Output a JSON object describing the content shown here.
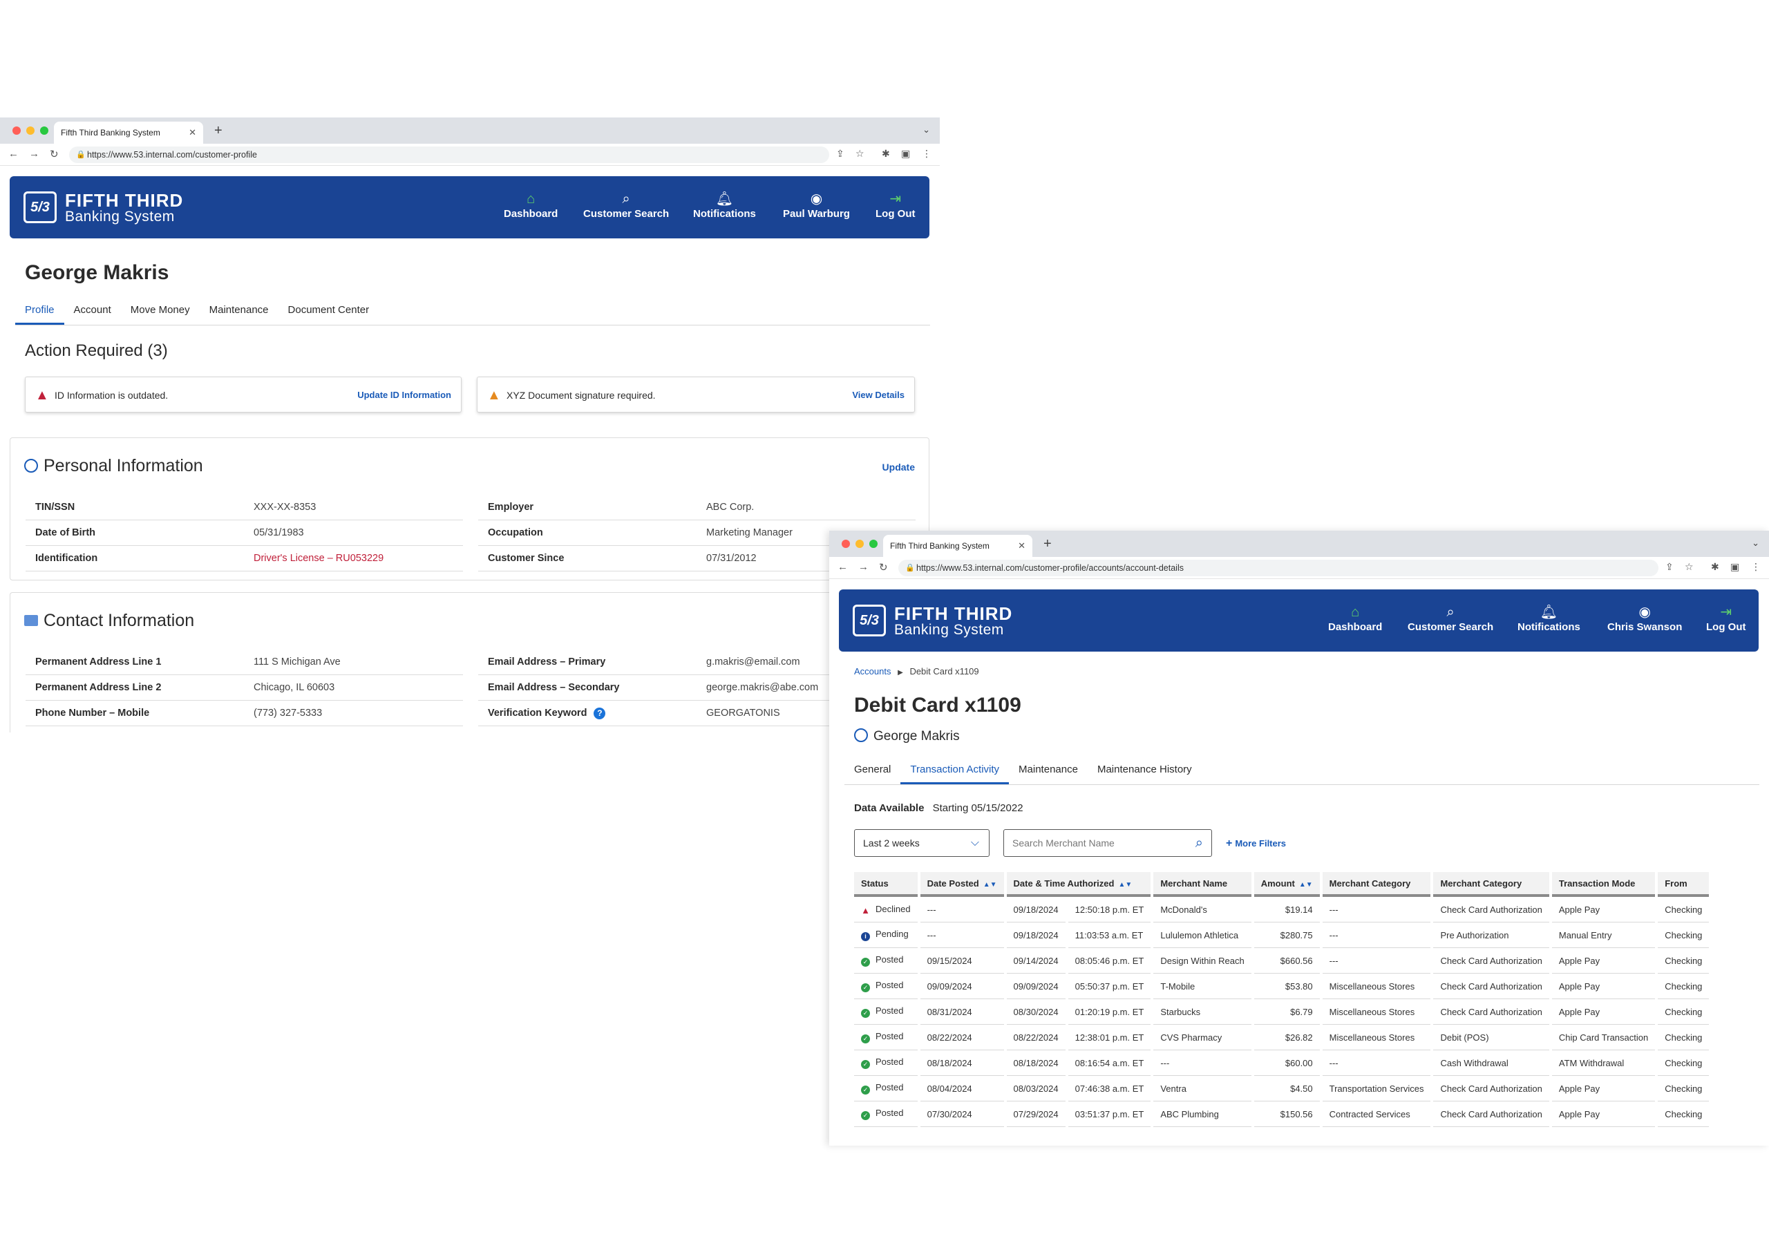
{
  "colors": {
    "brand": "#1a4494",
    "link": "#1a5bb8",
    "alert_red": "#c0203a",
    "alert_orange": "#e58a1f",
    "posted_green": "#2e9e4a"
  },
  "window1": {
    "browser": {
      "tab_title": "Fifth Third Banking System",
      "url": "https://www.53.internal.com/customer-profile"
    },
    "header": {
      "logo_mark": "5/3",
      "logo_line1": "FIFTH THIRD",
      "logo_line2": "Banking System",
      "nav": {
        "dashboard": "Dashboard",
        "search": "Customer Search",
        "notifications": "Notifications",
        "user": "Paul Warburg",
        "logout": "Log Out"
      }
    },
    "customer_name": "George Makris",
    "tabs": [
      "Profile",
      "Account",
      "Move Money",
      "Maintenance",
      "Document Center"
    ],
    "action_required": {
      "title": "Action Required (3)",
      "alerts": [
        {
          "message": "ID Information is outdated.",
          "link": "Update ID Information"
        },
        {
          "message": "XYZ Document signature required.",
          "link": "View Details"
        }
      ]
    },
    "personal": {
      "title": "Personal Information",
      "update_label": "Update",
      "left": [
        {
          "label": "TIN/SSN",
          "value": "XXX-XX-8353"
        },
        {
          "label": "Date of Birth",
          "value": "05/31/1983"
        },
        {
          "label": "Identification",
          "value": "Driver's License – RU053229"
        }
      ],
      "right": [
        {
          "label": "Employer",
          "value": "ABC Corp."
        },
        {
          "label": "Occupation",
          "value": "Marketing Manager"
        },
        {
          "label": "Customer Since",
          "value": "07/31/2012"
        }
      ]
    },
    "contact": {
      "title": "Contact Information",
      "left": [
        {
          "label": "Permanent Address Line 1",
          "value": "111 S Michigan Ave"
        },
        {
          "label": "Permanent Address Line 2",
          "value": "Chicago, IL 60603"
        },
        {
          "label": "Phone Number – Mobile",
          "value": "(773) 327-5333"
        }
      ],
      "right": [
        {
          "label": "Email Address – Primary",
          "value": "g.makris@email.com"
        },
        {
          "label": "Email Address – Secondary",
          "value": "george.makris@abe.com"
        },
        {
          "label": "Verification Keyword",
          "value": "GEORGATONIS"
        }
      ]
    }
  },
  "window2": {
    "browser": {
      "tab_title": "Fifth Third Banking System",
      "url": "https://www.53.internal.com/customer-profile/accounts/account-details"
    },
    "header": {
      "logo_mark": "5/3",
      "logo_line1": "FIFTH THIRD",
      "logo_line2": "Banking System",
      "nav": {
        "dashboard": "Dashboard",
        "search": "Customer Search",
        "notifications": "Notifications",
        "user": "Chris Swanson",
        "logout": "Log Out"
      }
    },
    "breadcrumb": {
      "parent": "Accounts",
      "current": "Debit Card x1109"
    },
    "title": "Debit Card x1109",
    "owner": "George Makris",
    "tabs": [
      "General",
      "Transaction Activity",
      "Maintenance",
      "Maintenance History"
    ],
    "data_available": {
      "label": "Data Available",
      "value": "Starting 05/15/2022"
    },
    "filters": {
      "range": "Last 2 weeks",
      "search_placeholder": "Search Merchant Name",
      "more_filters": "More Filters"
    },
    "columns": [
      "Status",
      "Date Posted",
      "Date & Time Authorized",
      "Merchant Name",
      "Amount",
      "Merchant Category",
      "Merchant Category",
      "Transaction Mode",
      "From"
    ],
    "rows": [
      {
        "status": "Declined",
        "posted": "---",
        "auth_date": "09/18/2024",
        "auth_time": "12:50:18 p.m. ET",
        "merchant": "McDonald's",
        "amount": "$19.14",
        "cat1": "---",
        "cat2": "Check Card Authorization",
        "mode": "Apple Pay",
        "from": "Checking"
      },
      {
        "status": "Pending",
        "posted": "---",
        "auth_date": "09/18/2024",
        "auth_time": "11:03:53 a.m. ET",
        "merchant": "Lululemon Athletica",
        "amount": "$280.75",
        "cat1": "---",
        "cat2": "Pre Authorization",
        "mode": "Manual Entry",
        "from": "Checking"
      },
      {
        "status": "Posted",
        "posted": "09/15/2024",
        "auth_date": "09/14/2024",
        "auth_time": "08:05:46 p.m. ET",
        "merchant": "Design Within Reach",
        "amount": "$660.56",
        "cat1": "---",
        "cat2": "Check Card Authorization",
        "mode": "Apple Pay",
        "from": "Checking"
      },
      {
        "status": "Posted",
        "posted": "09/09/2024",
        "auth_date": "09/09/2024",
        "auth_time": "05:50:37 p.m. ET",
        "merchant": "T-Mobile",
        "amount": "$53.80",
        "cat1": "Miscellaneous Stores",
        "cat2": "Check Card Authorization",
        "mode": "Apple Pay",
        "from": "Checking"
      },
      {
        "status": "Posted",
        "posted": "08/31/2024",
        "auth_date": "08/30/2024",
        "auth_time": "01:20:19 p.m. ET",
        "merchant": "Starbucks",
        "amount": "$6.79",
        "cat1": "Miscellaneous Stores",
        "cat2": "Check Card Authorization",
        "mode": "Apple Pay",
        "from": "Checking"
      },
      {
        "status": "Posted",
        "posted": "08/22/2024",
        "auth_date": "08/22/2024",
        "auth_time": "12:38:01 p.m. ET",
        "merchant": "CVS Pharmacy",
        "amount": "$26.82",
        "cat1": "Miscellaneous Stores",
        "cat2": "Debit (POS)",
        "mode": "Chip Card Transaction",
        "from": "Checking"
      },
      {
        "status": "Posted",
        "posted": "08/18/2024",
        "auth_date": "08/18/2024",
        "auth_time": "08:16:54 a.m. ET",
        "merchant": "---",
        "amount": "$60.00",
        "cat1": "---",
        "cat2": "Cash Withdrawal",
        "mode": "ATM Withdrawal",
        "from": "Checking"
      },
      {
        "status": "Posted",
        "posted": "08/04/2024",
        "auth_date": "08/03/2024",
        "auth_time": "07:46:38 a.m. ET",
        "merchant": "Ventra",
        "amount": "$4.50",
        "cat1": "Transportation Services",
        "cat2": "Check Card Authorization",
        "mode": "Apple Pay",
        "from": "Checking"
      },
      {
        "status": "Posted",
        "posted": "07/30/2024",
        "auth_date": "07/29/2024",
        "auth_time": "03:51:37 p.m. ET",
        "merchant": "ABC Plumbing",
        "amount": "$150.56",
        "cat1": "Contracted Services",
        "cat2": "Check Card Authorization",
        "mode": "Apple Pay",
        "from": "Checking"
      }
    ]
  }
}
